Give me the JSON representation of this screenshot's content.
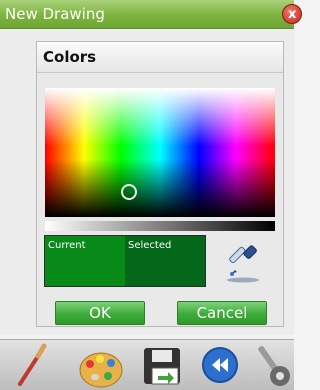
{
  "window": {
    "title": "New Drawing"
  },
  "colors_panel": {
    "title": "Colors",
    "current_label": "Current",
    "selected_label": "Selected",
    "current_color": "#088a18",
    "selected_color": "#04681a"
  },
  "buttons": {
    "ok": "OK",
    "cancel": "Cancel"
  },
  "toolbar": {
    "icons": [
      "brush-icon",
      "palette-icon",
      "save-icon",
      "back-icon",
      "settings-icon"
    ]
  }
}
